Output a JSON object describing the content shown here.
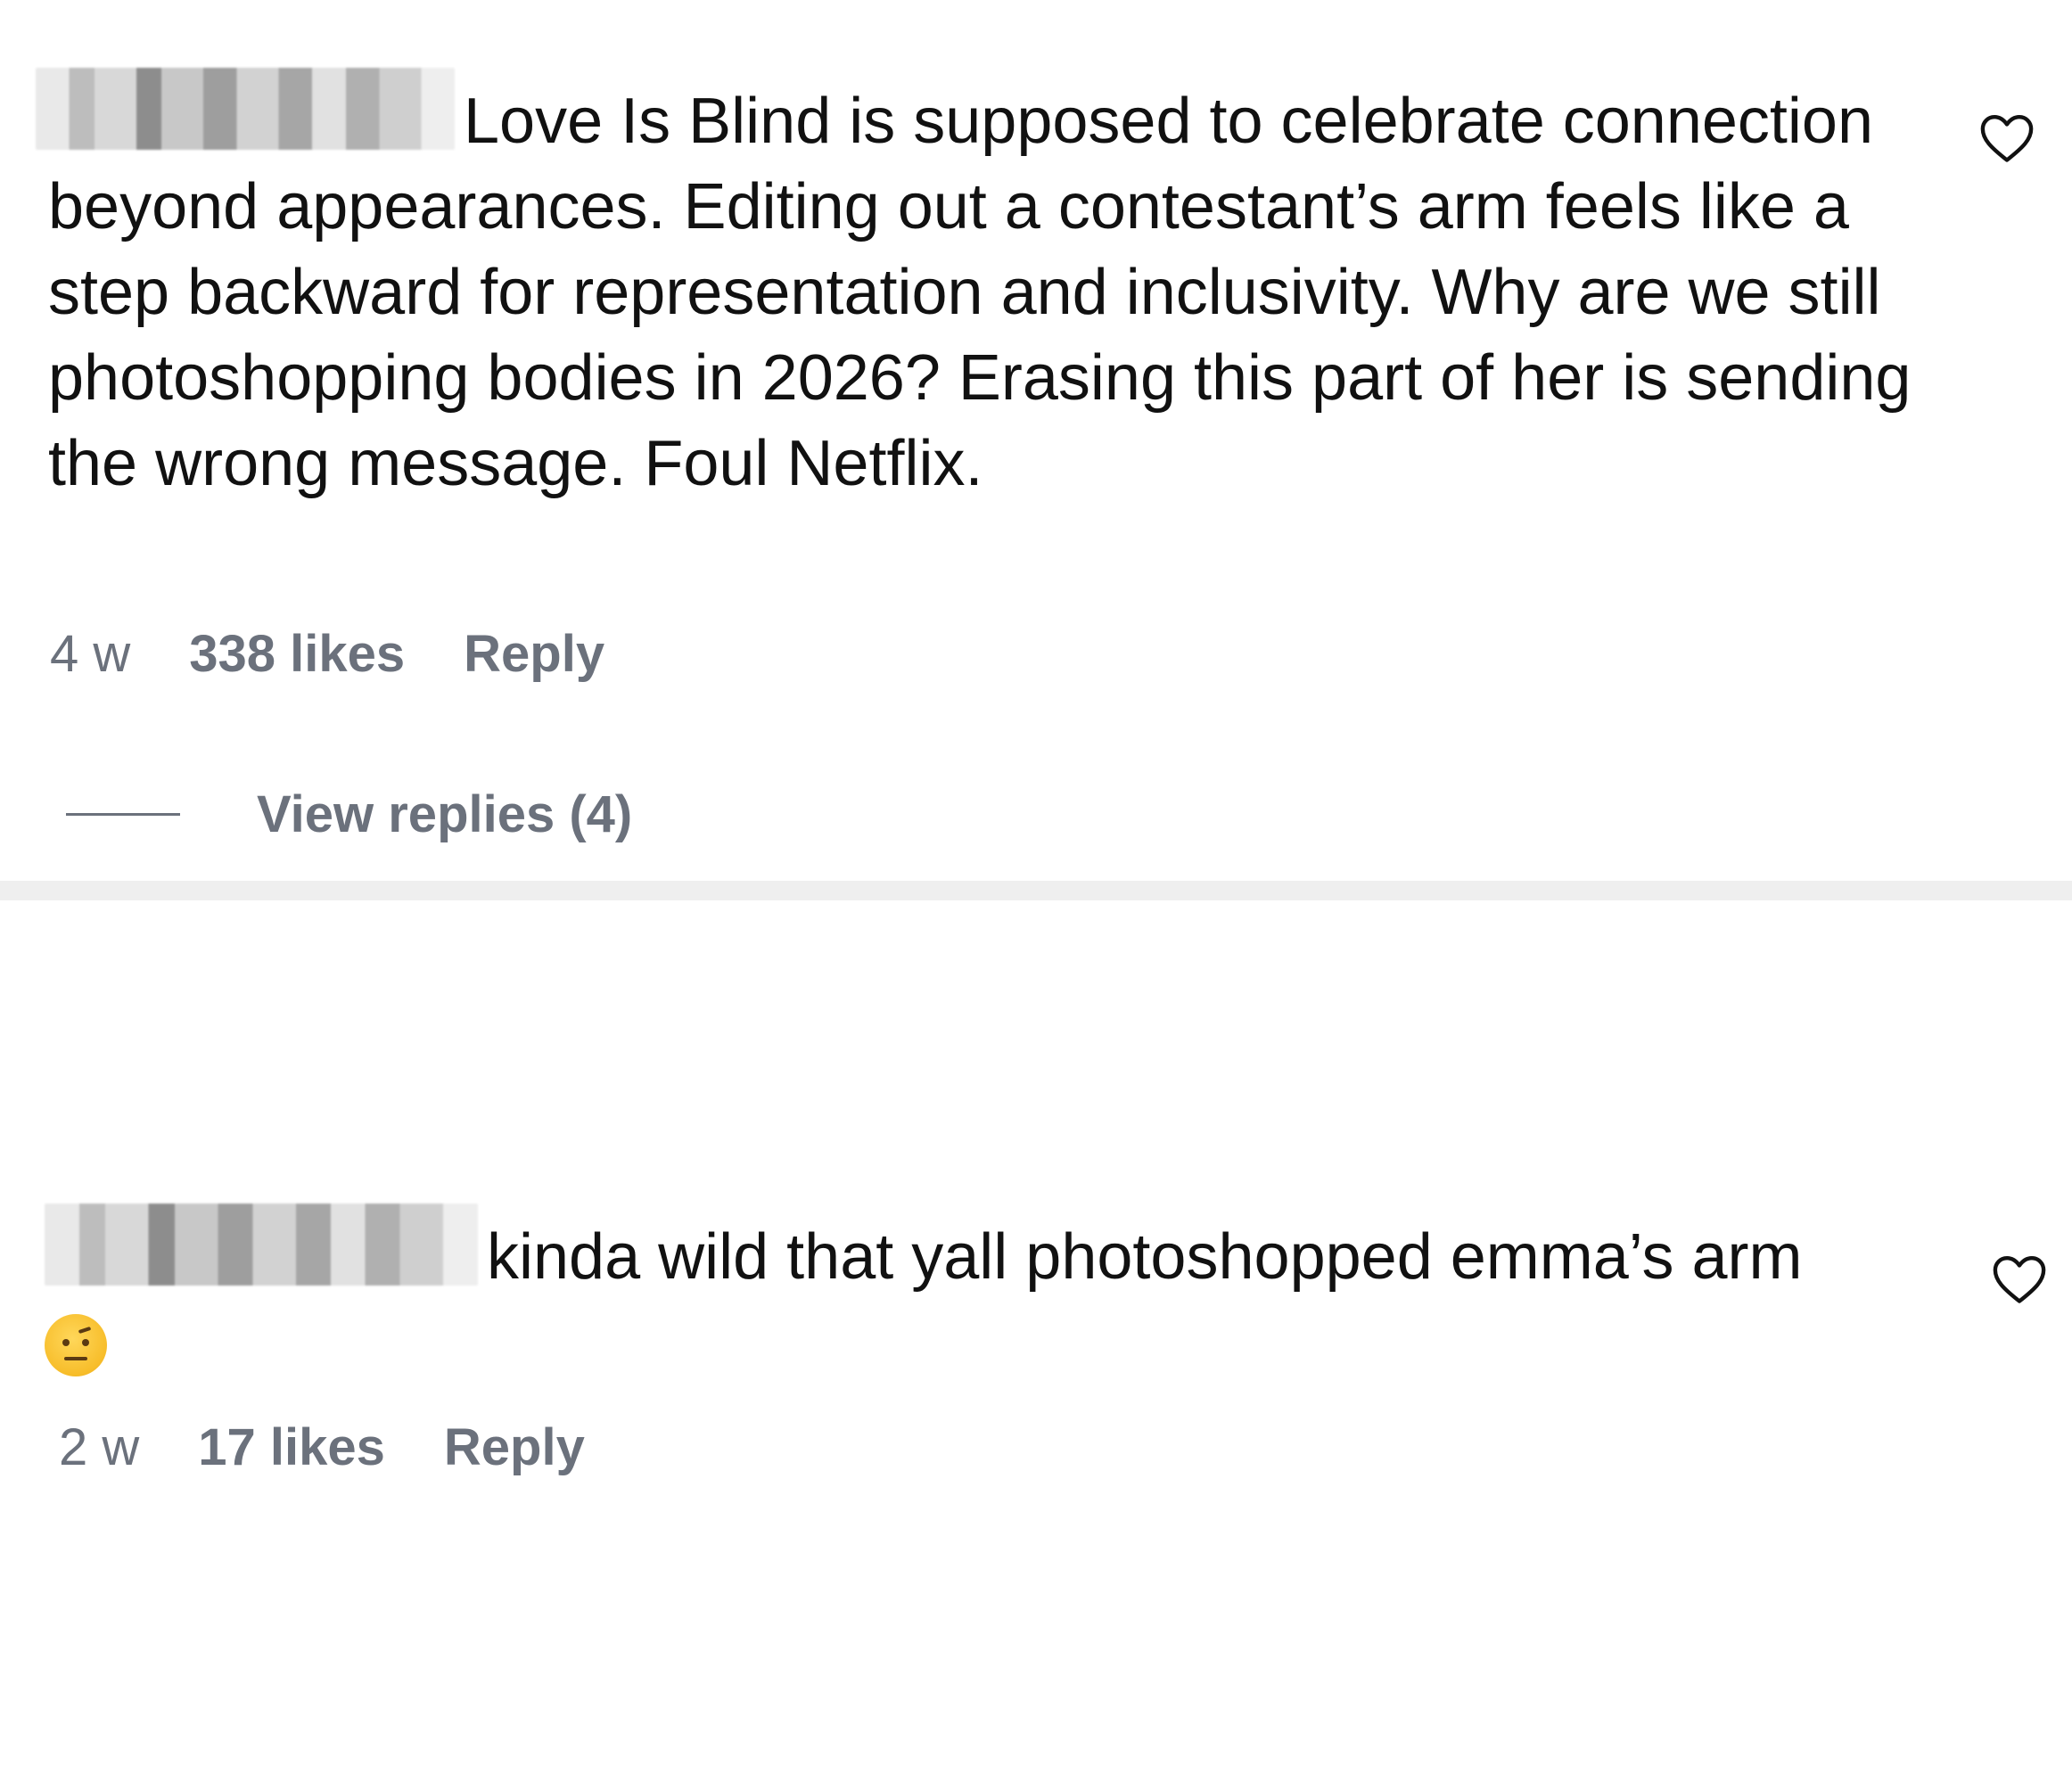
{
  "comments": [
    {
      "text": "Love Is Blind is supposed to celebrate connection beyond appearances. Editing out a contestant’s arm feels like a step backward for representation and inclusivity. Why are we still photoshopping bodies in 2026? Erasing this part of her is sending the wrong message. Foul Netflix.",
      "time": "4 w",
      "likes": "338 likes",
      "reply_label": "Reply",
      "view_replies": "View replies (4)"
    },
    {
      "text": "kinda wild that yall photoshopped emma’s arm",
      "emoji": "face-with-raised-eyebrow",
      "time": "2 w",
      "likes": "17 likes",
      "reply_label": "Reply"
    }
  ],
  "colors": {
    "text": "#111111",
    "meta": "#6b717c",
    "separator": "#efefef",
    "background": "#ffffff"
  },
  "icons": [
    "heart-outline-icon",
    "face-with-raised-eyebrow-emoji"
  ]
}
